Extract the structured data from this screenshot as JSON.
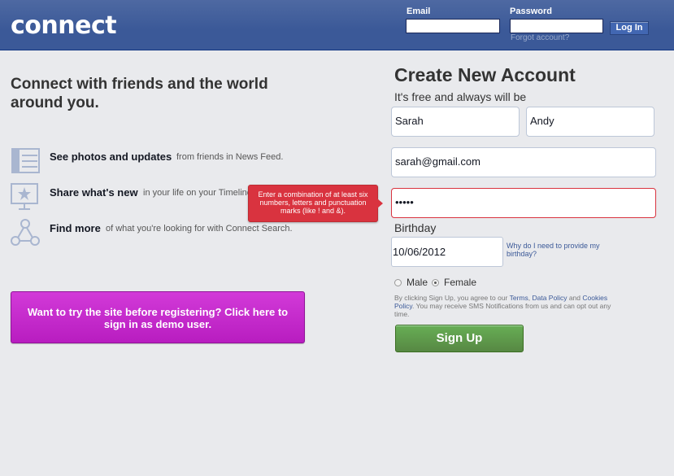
{
  "header": {
    "logo": "connect",
    "email_label": "Email",
    "password_label": "Password",
    "login_button": "Log In",
    "forgot_link": "Forgot account?"
  },
  "left": {
    "tagline": "Connect with friends and the world around you.",
    "features": [
      {
        "icon": "news-feed-icon",
        "title": "See photos and updates",
        "desc": "from friends in News Feed."
      },
      {
        "icon": "timeline-icon",
        "title": "Share what's new",
        "desc": "in your life on your Timeline."
      },
      {
        "icon": "search-graph-icon",
        "title": "Find more",
        "desc": "of what you're looking for with Connect Search."
      }
    ],
    "demo_button": "Want to try the site before registering? Click here to sign in as demo user."
  },
  "tooltip": "Enter a combination of at least six numbers, letters and punctuation marks (like ! and &).",
  "signup": {
    "title": "Create New Account",
    "subtitle": "It's free and always will be",
    "first_name": "Sarah",
    "last_name": "Andy",
    "email": "sarah@gmail.com",
    "password": "•••••",
    "birthday_label": "Birthday",
    "birthday": "10/06/2012",
    "why_link": "Why do I need to provide my birthday?",
    "gender_male": "Male",
    "gender_female": "Female",
    "gender_selected": "Female",
    "terms_prefix": "By clicking Sign Up, you agree to our ",
    "terms_link": "Terms",
    "terms_sep1": ", ",
    "data_policy_link": "Data Policy",
    "terms_and": " and ",
    "cookies_link": "Cookies Policy",
    "terms_suffix": ". You may receive SMS Notifications from us and can opt out any time.",
    "button": "Sign Up"
  },
  "colors": {
    "header": "#3b5998",
    "demo_button": "#c02bc8",
    "signup_button": "#5fa04d",
    "error": "#d9333f"
  }
}
